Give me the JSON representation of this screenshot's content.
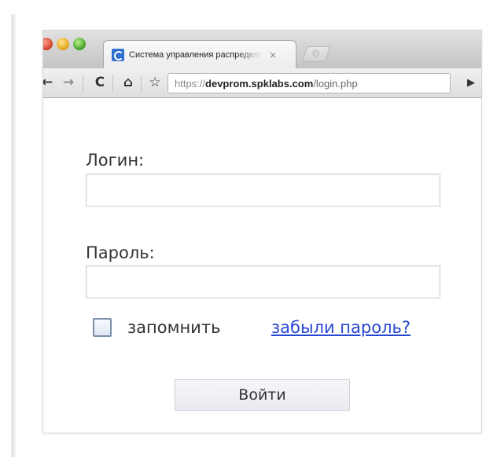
{
  "browser": {
    "tab": {
      "title": "Система управления распределенными проектами",
      "close_glyph": "×"
    },
    "toolbar": {
      "back_glyph": "←",
      "forward_glyph": "→",
      "reload_glyph": "C",
      "home_glyph": "⌂",
      "star_glyph": "☆",
      "go_glyph": "▶"
    },
    "address": {
      "scheme": "https://",
      "host": "devprom.spklabs.com",
      "path": "/login.php"
    },
    "icons": [
      "close-window",
      "minimize-window",
      "zoom-window",
      "favicon",
      "back-icon",
      "forward-icon",
      "reload-icon",
      "home-icon",
      "star-icon",
      "go-icon"
    ]
  },
  "form": {
    "login_label": "Логин:",
    "login_value": "",
    "password_label": "Пароль:",
    "password_value": "",
    "remember_label": "запомнить",
    "remember_checked": false,
    "forgot_link": "забыли пароль?",
    "submit_label": "Войти"
  },
  "colors": {
    "link": "#2747d0",
    "text": "#333333"
  }
}
